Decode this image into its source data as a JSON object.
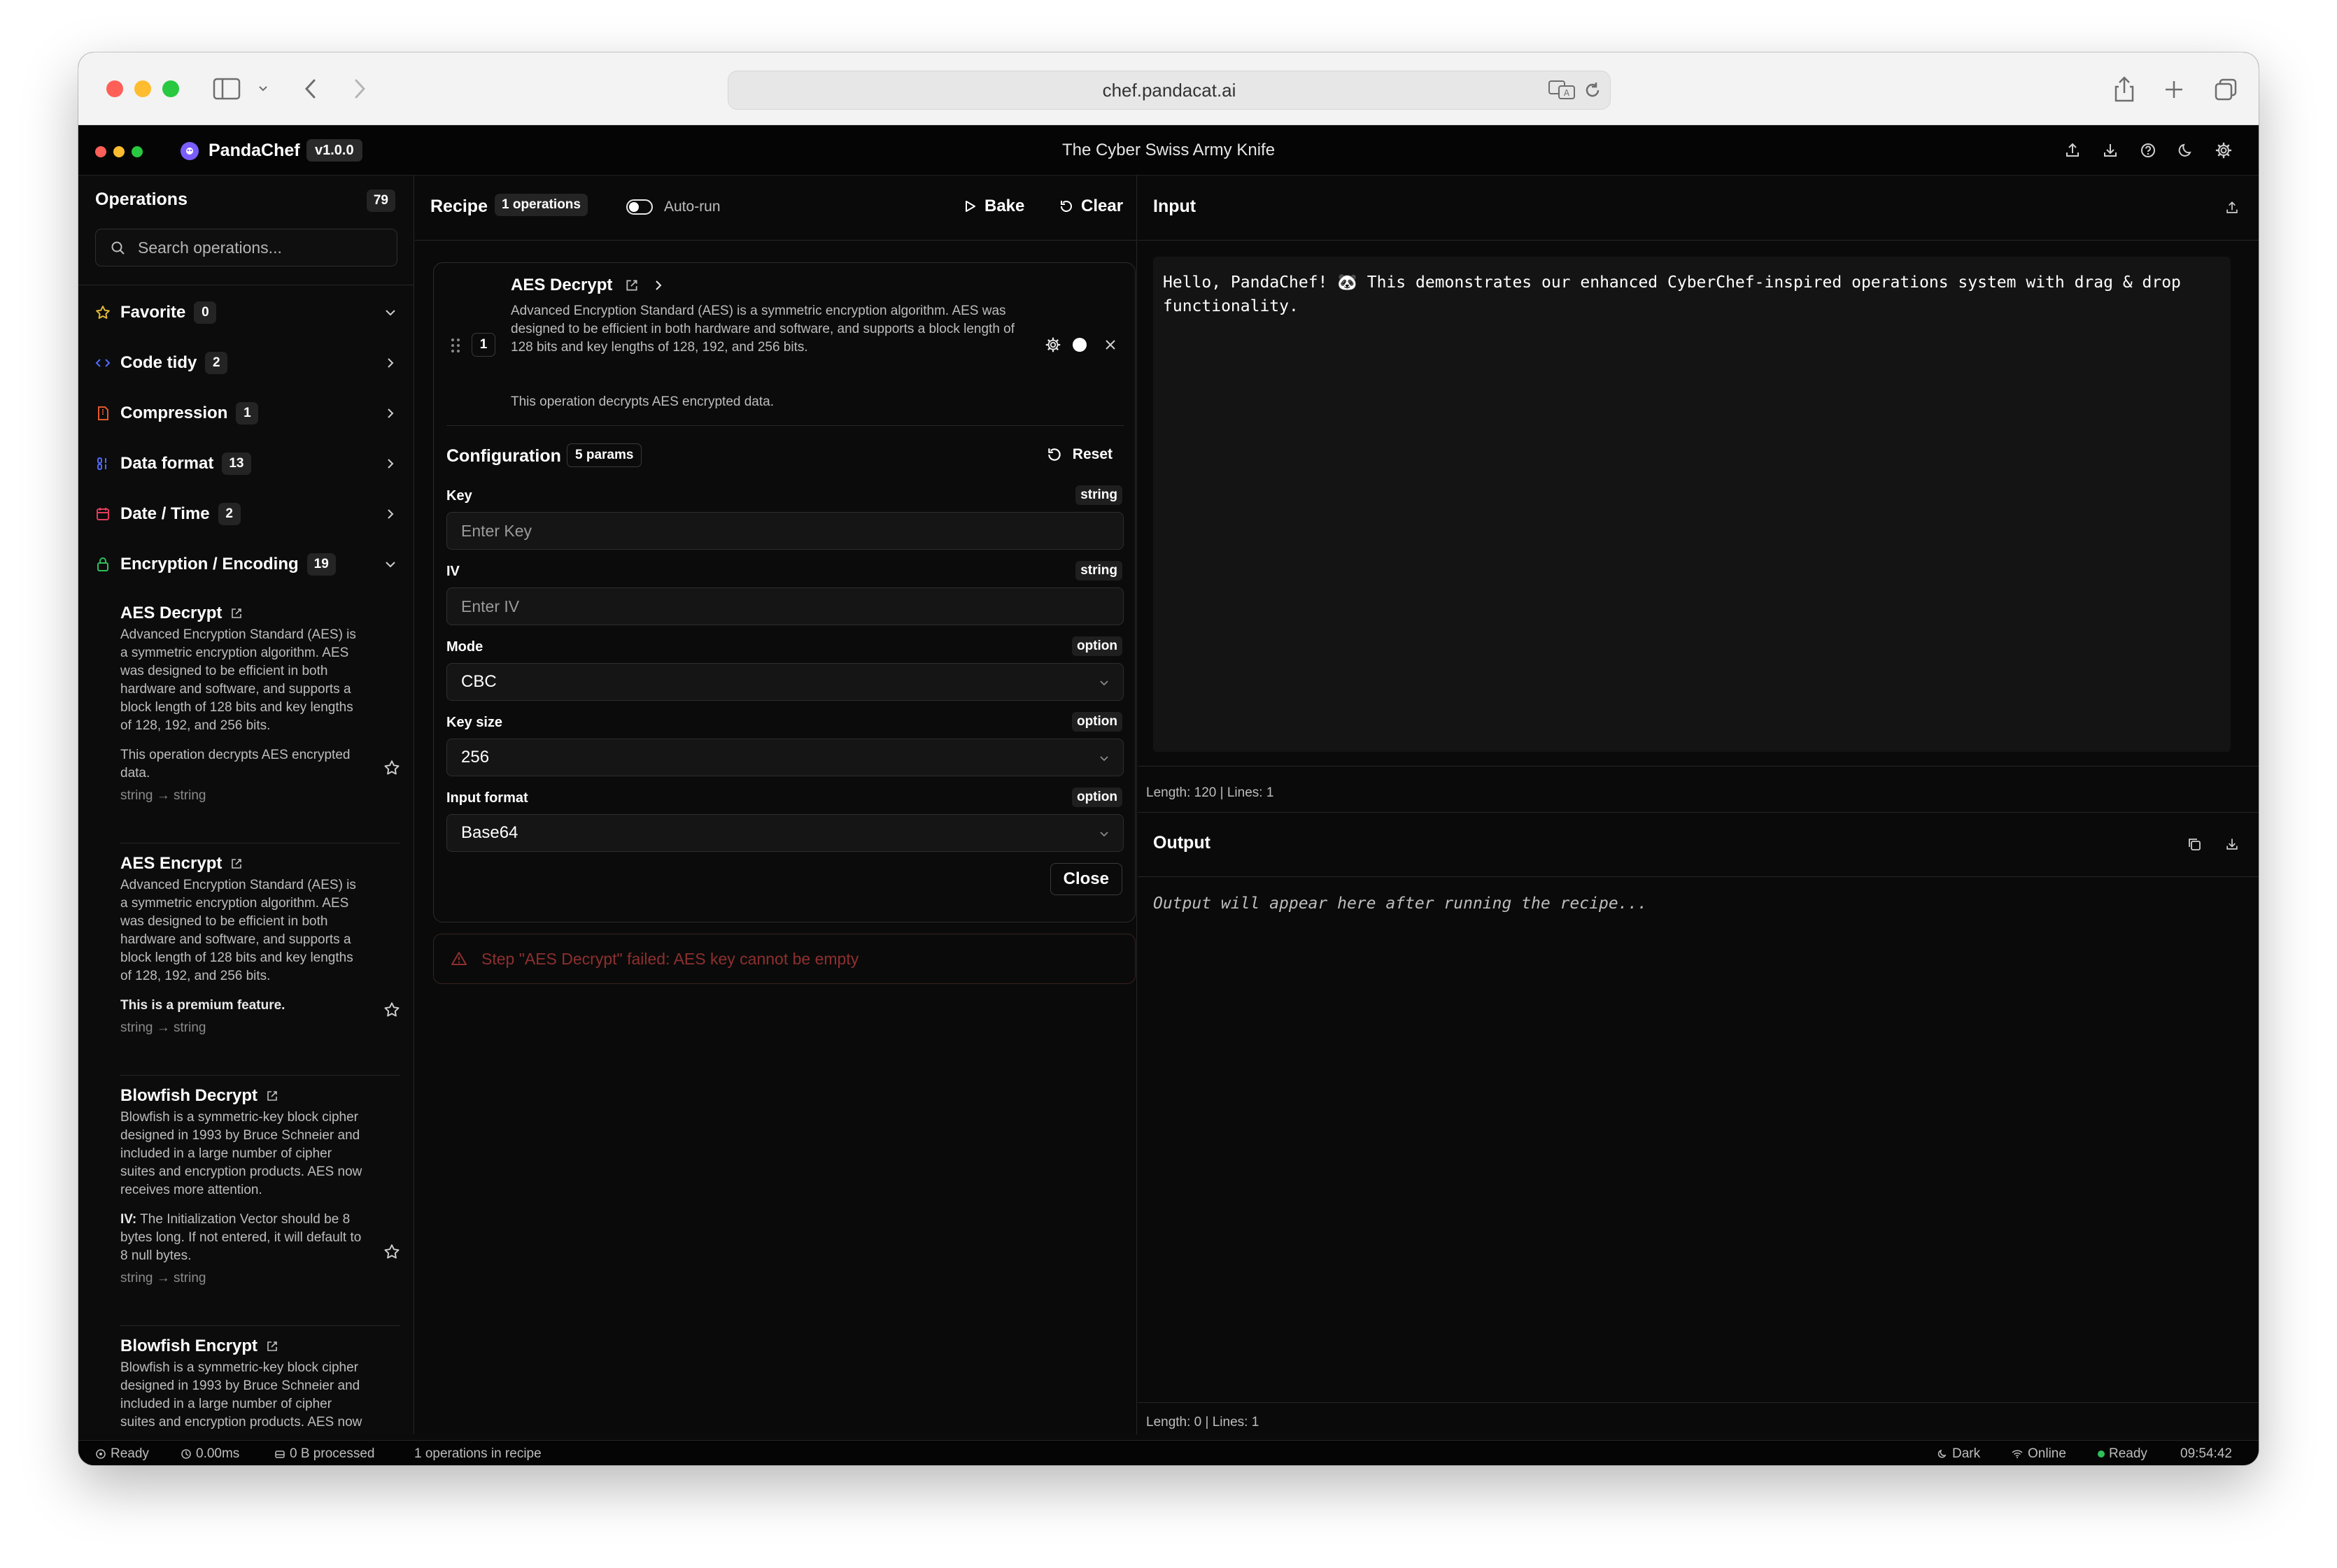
{
  "browser": {
    "url": "chef.pandacat.ai"
  },
  "app": {
    "name": "PandaChef",
    "version": "v1.0.0",
    "subtitle": "The Cyber Swiss Army Knife"
  },
  "sidebar": {
    "title": "Operations",
    "count": "79",
    "search_placeholder": "Search operations...",
    "categories": [
      {
        "label": "Favorite",
        "count": "0",
        "icon": "star-icon",
        "color": "#e0b93a"
      },
      {
        "label": "Code tidy",
        "count": "2",
        "icon": "code-icon",
        "color": "#4f6bff"
      },
      {
        "label": "Compression",
        "count": "1",
        "icon": "file-zip-icon",
        "color": "#e2582b"
      },
      {
        "label": "Data format",
        "count": "13",
        "icon": "binary-icon",
        "color": "#4f6bff"
      },
      {
        "label": "Date / Time",
        "count": "2",
        "icon": "calendar-icon",
        "color": "#e23b5a"
      },
      {
        "label": "Encryption / Encoding",
        "count": "19",
        "icon": "lock-icon",
        "color": "#2fbf5a"
      }
    ],
    "operations": [
      {
        "title": "AES Decrypt",
        "desc": "Advanced Encryption Standard (AES) is a symmetric encryption algorithm. AES was designed to be efficient in both hardware and software, and supports a block length of 128 bits and key lengths of 128, 192, and 256 bits.",
        "extra": "This operation decrypts AES encrypted data.",
        "types": "string → string"
      },
      {
        "title": "AES Encrypt",
        "desc": "Advanced Encryption Standard (AES) is a symmetric encryption algorithm. AES was designed to be efficient in both hardware and software, and supports a block length of 128 bits and key lengths of 128, 192, and 256 bits.",
        "extra": "This is a premium feature.",
        "types": "string → string"
      },
      {
        "title": "Blowfish Decrypt",
        "desc": "Blowfish is a symmetric-key block cipher designed in 1993 by Bruce Schneier and included in a large number of cipher suites and encryption products. AES now receives more attention.",
        "extra_label": "IV:",
        "extra": " The Initialization Vector should be 8 bytes long. If not entered, it will default to 8 null bytes.",
        "types": "string → string"
      },
      {
        "title": "Blowfish Encrypt",
        "desc": "Blowfish is a symmetric-key block cipher designed in 1993 by Bruce Schneier and included in a large number of cipher suites and encryption products. AES now"
      }
    ]
  },
  "recipe": {
    "title": "Recipe",
    "count_badge": "1 operations",
    "autorun_label": "Auto-run",
    "bake_label": "Bake",
    "clear_label": "Clear",
    "step": {
      "number": "1",
      "title": "AES Decrypt",
      "desc": "Advanced Encryption Standard (AES) is a symmetric encryption algorithm. AES was designed to be efficient in both hardware and software, and supports a block length of 128 bits and key lengths of 128, 192, and 256 bits.",
      "extra": "This operation decrypts AES encrypted data."
    },
    "config": {
      "title": "Configuration",
      "params_badge": "5 params",
      "reset_label": "Reset",
      "params": [
        {
          "label": "Key",
          "type": "string",
          "placeholder": "Enter Key"
        },
        {
          "label": "IV",
          "type": "string",
          "placeholder": "Enter IV"
        },
        {
          "label": "Mode",
          "type": "option",
          "value": "CBC"
        },
        {
          "label": "Key size",
          "type": "option",
          "value": "256"
        },
        {
          "label": "Input format",
          "type": "option",
          "value": "Base64"
        }
      ],
      "close_label": "Close"
    },
    "error": "Step \"AES Decrypt\" failed: AES key cannot be empty"
  },
  "input": {
    "title": "Input",
    "text_before": "Hello, PandaChef! ",
    "text_emoji": "🐼",
    "text_after": " This demonstrates our enhanced CyberChef-inspired operations system with drag & drop functionality.",
    "meta": "Length: 120 | Lines: 1"
  },
  "output": {
    "title": "Output",
    "placeholder": "Output will appear here after running the recipe...",
    "meta": "Length: 0 | Lines: 1"
  },
  "statusbar": {
    "ready": "Ready",
    "time": "0.00ms",
    "processed": "0 B processed",
    "ops_in_recipe": "1 operations in recipe",
    "theme": "Dark",
    "network": "Online",
    "status": "Ready",
    "clock": "09:54:42"
  }
}
